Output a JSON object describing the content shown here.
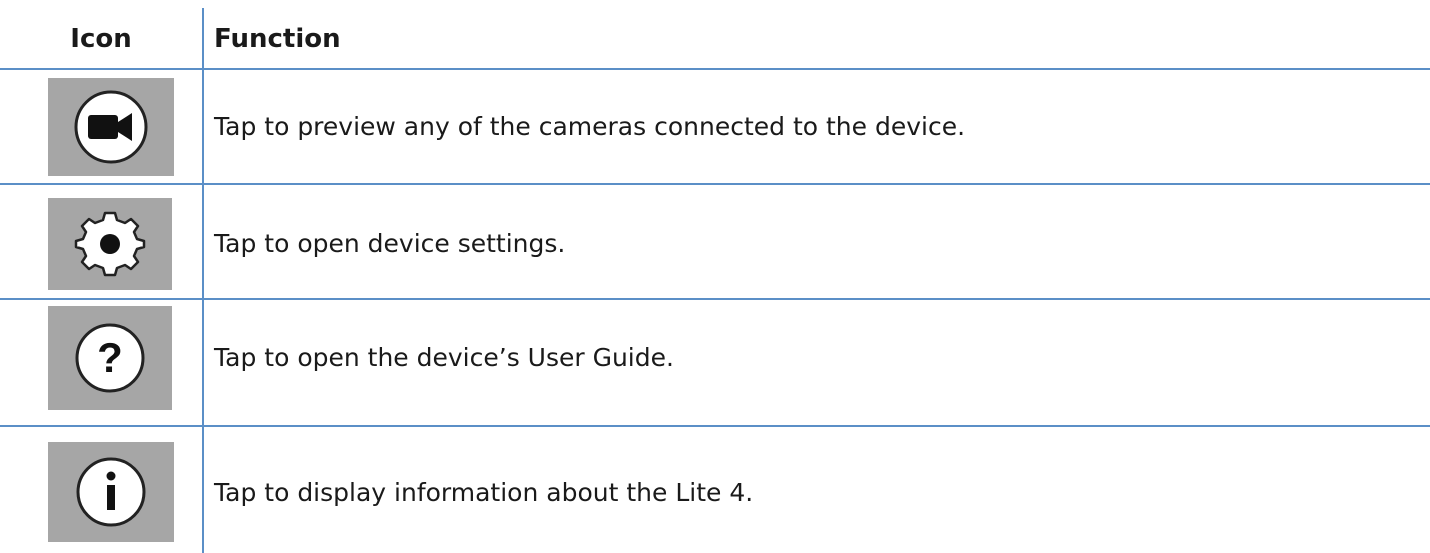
{
  "table": {
    "header": {
      "icon_col": "Icon",
      "function_col": "Function"
    },
    "rows": [
      {
        "icon": "video-camera-icon",
        "text": "Tap to preview any of the cameras connected to the device."
      },
      {
        "icon": "gear-icon",
        "text": "Tap to open device settings."
      },
      {
        "icon": "question-mark-icon",
        "text": "Tap to open the device’s User Guide."
      },
      {
        "icon": "info-icon",
        "text": "Tap to display information about the Lite 4."
      }
    ]
  },
  "colors": {
    "rule": "#5b8fc7",
    "icon_background": "#a6a6a6",
    "icon_circle": "#ffffff",
    "icon_glyph": "#111111"
  }
}
